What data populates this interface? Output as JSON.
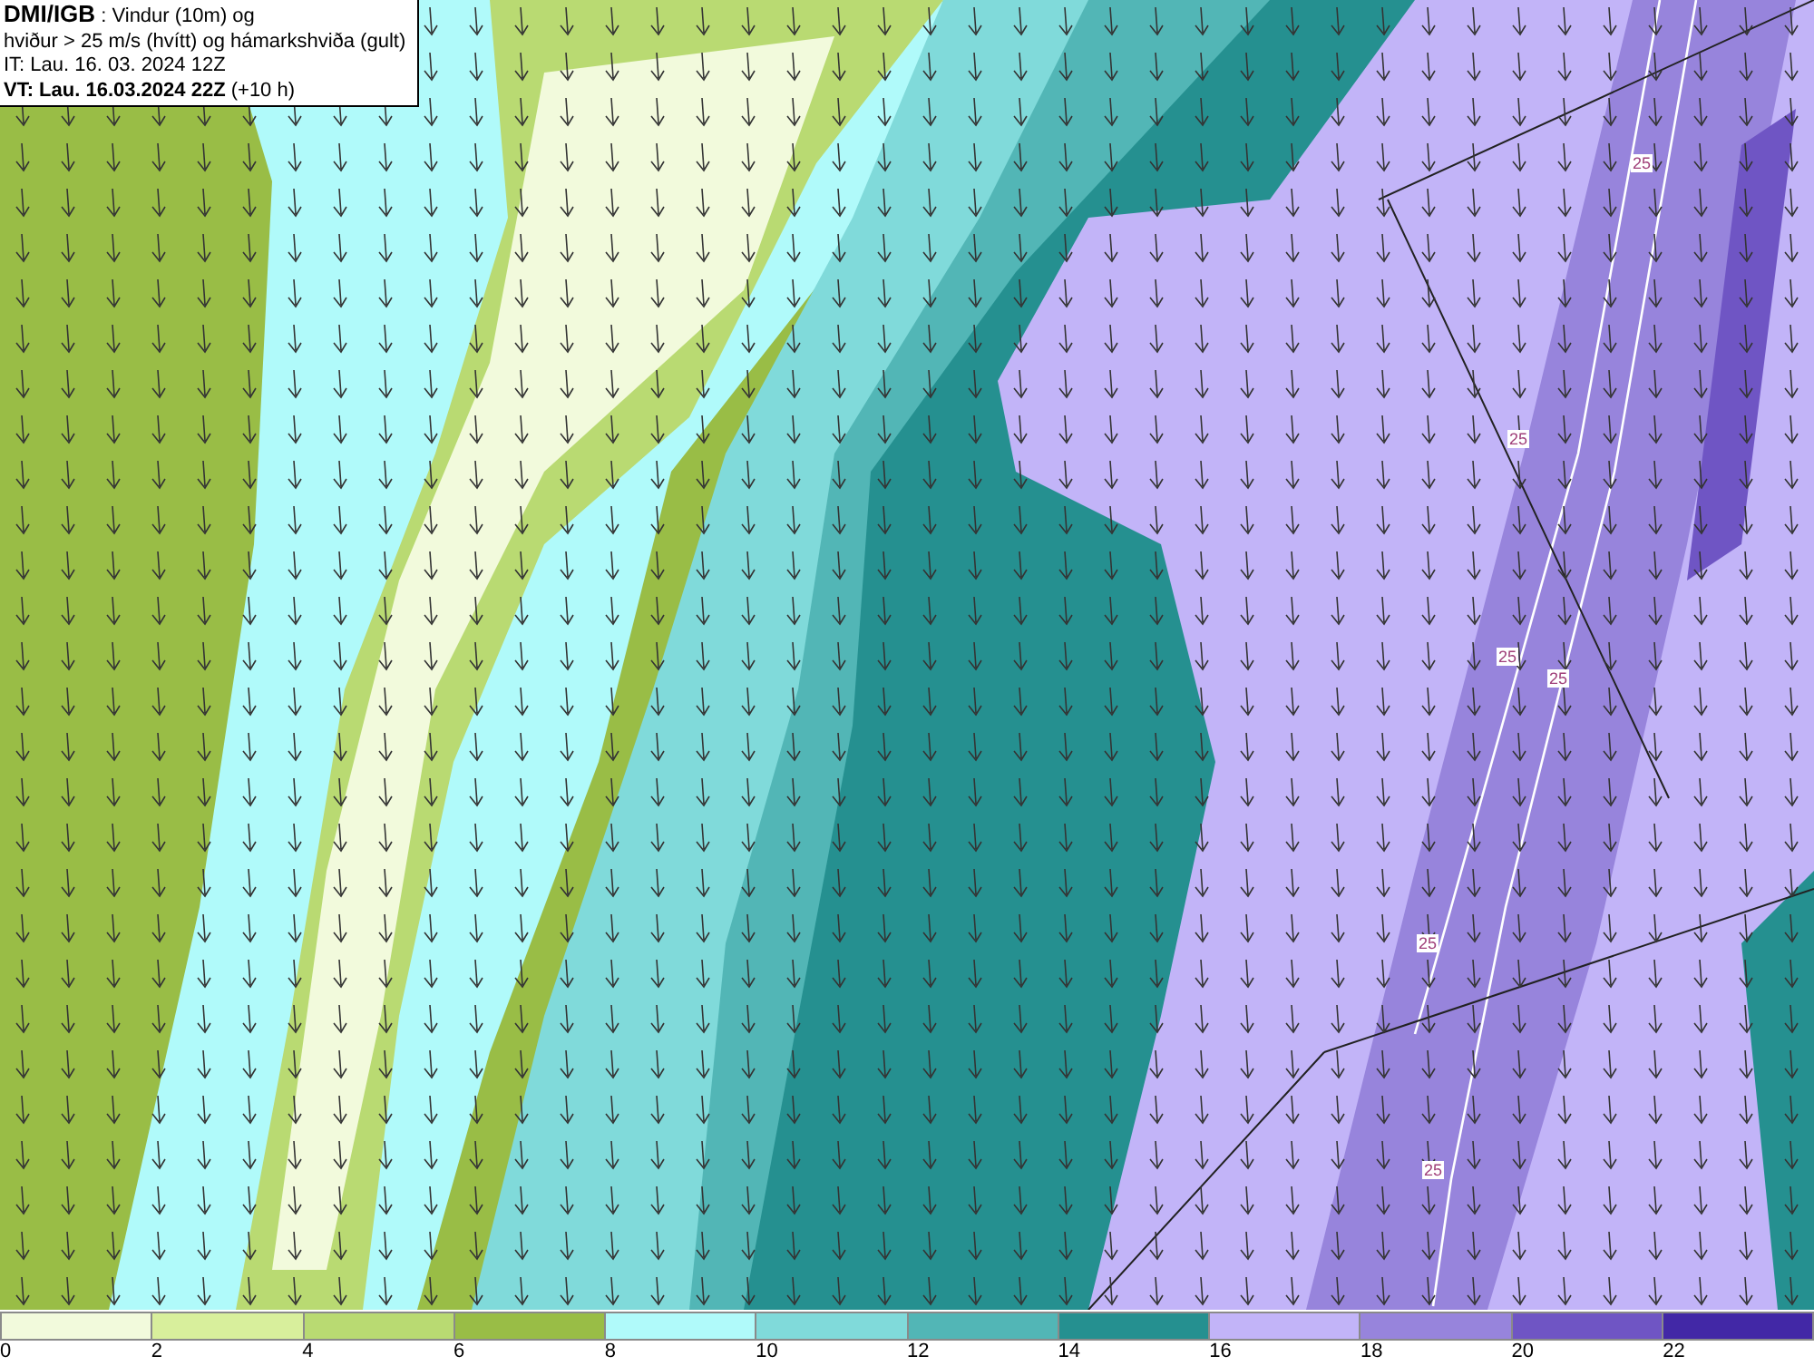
{
  "header": {
    "line_1": "**DMI/IGB** : Vindur (10m) og",
    "line_2": "hviður > 25 m/s (hvítt) og hámarkshviða (gult)",
    "line_3": "IT: Lau. 16. 03. 2024 12Z",
    "line_4": "**VT: Lau. 16.03.2024 22Z** (+10 h)"
  },
  "map": {
    "contour_labels": [
      "25",
      "25",
      "25",
      "25",
      "25",
      "25"
    ]
  },
  "legend": {
    "bins": [
      {
        "color": "#f2fadc",
        "tick": "0"
      },
      {
        "color": "#d8ef9c",
        "tick": "2"
      },
      {
        "color": "#b9da72",
        "tick": "4"
      },
      {
        "color": "#99bd46",
        "tick": "6"
      },
      {
        "color": "#b0fafa",
        "tick": "8"
      },
      {
        "color": "#80dada",
        "tick": "10"
      },
      {
        "color": "#52b6b6",
        "tick": "12"
      },
      {
        "color": "#259090",
        "tick": "14"
      },
      {
        "color": "#c2b4f8",
        "tick": "16"
      },
      {
        "color": "#9784dc",
        "tick": "18"
      },
      {
        "color": "#6f55c4",
        "tick": "20"
      },
      {
        "color": "#4228a6",
        "tick": "22"
      }
    ]
  }
}
